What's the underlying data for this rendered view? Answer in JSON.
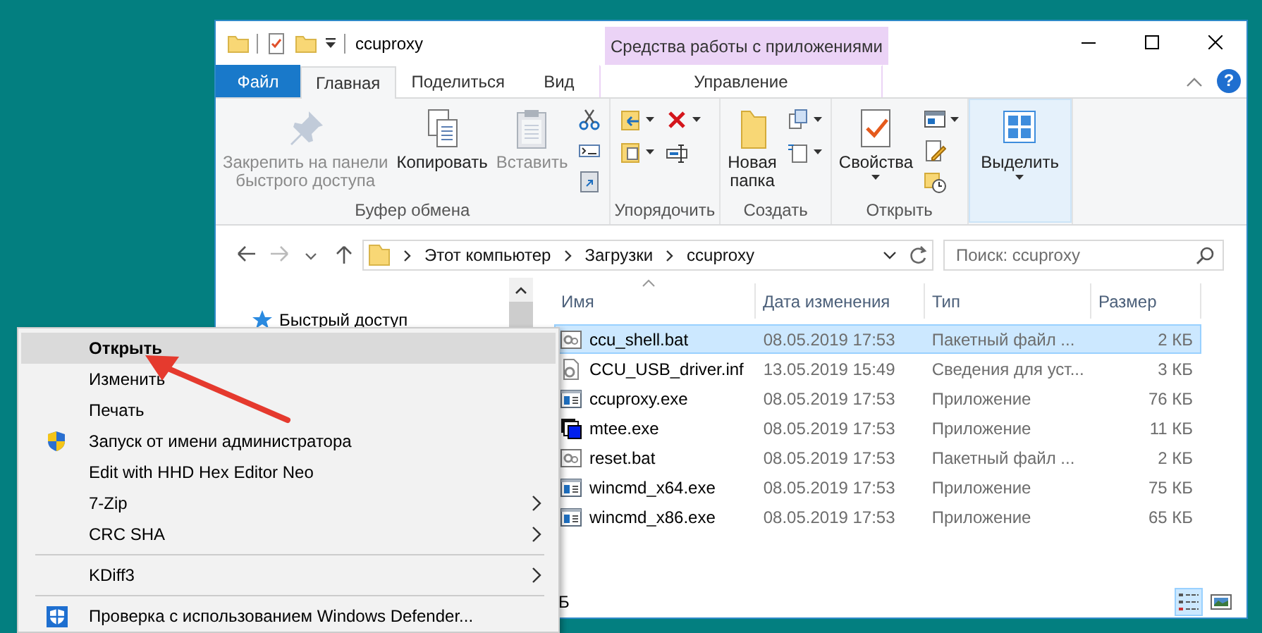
{
  "window": {
    "title": "ccuproxy",
    "contextual_group": "Средства работы с приложениями",
    "help": "?"
  },
  "tabs": [
    {
      "label": "Файл",
      "kind": "file",
      "selected": false
    },
    {
      "label": "Главная",
      "kind": "tab",
      "selected": true
    },
    {
      "label": "Поделиться",
      "kind": "tab",
      "selected": false
    },
    {
      "label": "Вид",
      "kind": "tab",
      "selected": false
    },
    {
      "label": "Управление",
      "kind": "contextual",
      "selected": false
    }
  ],
  "ribbon": [
    {
      "label": "Буфер обмена",
      "commands": [
        {
          "kind": "pin",
          "label": "Закрепить на панели\nбыстрого доступа",
          "disabled": true,
          "highlighted": false
        },
        {
          "kind": "copy",
          "label": "Копировать",
          "disabled": false,
          "highlighted": false
        },
        {
          "kind": "paste",
          "label": "Вставить",
          "disabled": true,
          "highlighted": false
        },
        {
          "kind": "cut",
          "disabled": false,
          "highlighted": false
        },
        {
          "kind": "copy-path",
          "disabled": false,
          "highlighted": false
        },
        {
          "kind": "paste-shortcut",
          "disabled": false,
          "highlighted": false
        }
      ]
    },
    {
      "label": "Упорядочить",
      "commands": [
        {
          "kind": "move-to",
          "disabled": false,
          "highlighted": false
        },
        {
          "kind": "copy-to",
          "disabled": false,
          "highlighted": false
        },
        {
          "kind": "delete",
          "disabled": false,
          "highlighted": false
        },
        {
          "kind": "rename",
          "disabled": false,
          "highlighted": false
        }
      ]
    },
    {
      "label": "Создать",
      "commands": [
        {
          "kind": "new-folder",
          "label": "Новая\nпапка",
          "disabled": false,
          "highlighted": false
        },
        {
          "kind": "new-item",
          "disabled": false,
          "highlighted": false
        },
        {
          "kind": "easy-access",
          "disabled": false,
          "highlighted": false
        }
      ]
    },
    {
      "label": "Открыть",
      "commands": [
        {
          "kind": "properties",
          "label": "Свойства",
          "disabled": false,
          "highlighted": false
        },
        {
          "kind": "open",
          "disabled": false,
          "highlighted": false
        },
        {
          "kind": "edit",
          "disabled": false,
          "highlighted": false
        },
        {
          "kind": "history",
          "disabled": false,
          "highlighted": false
        }
      ]
    },
    {
      "commands": [
        {
          "kind": "select",
          "label": "Выделить",
          "disabled": false,
          "highlighted": true
        }
      ]
    }
  ],
  "address": {
    "crumbs": [
      "Этот компьютер",
      "Загрузки",
      "ccuproxy"
    ]
  },
  "search": {
    "placeholder": "Поиск: ccuproxy"
  },
  "nav_pane": [
    {
      "label": "Быстрый доступ",
      "kind": "quick-access"
    }
  ],
  "file_list": {
    "columns": [
      {
        "label": "Имя",
        "sorted": true
      },
      {
        "label": "Дата изменения",
        "sorted": false
      },
      {
        "label": "Тип",
        "sorted": false
      },
      {
        "label": "Размер",
        "sorted": false
      }
    ],
    "rows": [
      {
        "name": "ccu_shell.bat",
        "date": "08.05.2019 17:53",
        "type": "Пакетный файл ...",
        "size": "2 КБ",
        "kind": "bat",
        "selected": true
      },
      {
        "name": "CCU_USB_driver.inf",
        "date": "13.05.2019 15:49",
        "type": "Сведения для уст...",
        "size": "3 КБ",
        "kind": "inf",
        "selected": false
      },
      {
        "name": "ccuproxy.exe",
        "date": "08.05.2019 17:53",
        "type": "Приложение",
        "size": "76 КБ",
        "kind": "exe",
        "selected": false
      },
      {
        "name": "mtee.exe",
        "date": "08.05.2019 17:53",
        "type": "Приложение",
        "size": "11 КБ",
        "kind": "console",
        "selected": false
      },
      {
        "name": "reset.bat",
        "date": "08.05.2019 17:53",
        "type": "Пакетный файл ...",
        "size": "2 КБ",
        "kind": "bat",
        "selected": false
      },
      {
        "name": "wincmd_x64.exe",
        "date": "08.05.2019 17:53",
        "type": "Приложение",
        "size": "75 КБ",
        "kind": "exe",
        "selected": false
      },
      {
        "name": "wincmd_x86.exe",
        "date": "08.05.2019 17:53",
        "type": "Приложение",
        "size": "65 КБ",
        "kind": "exe",
        "selected": false
      }
    ]
  },
  "status_bar": {
    "text": "Б",
    "view_modes": [
      {
        "kind": "details",
        "selected": true
      },
      {
        "kind": "tiles",
        "selected": false
      }
    ]
  },
  "context_menu": [
    {
      "kind": "item",
      "label": "Открыть",
      "default": true,
      "selected": true,
      "submenu": false
    },
    {
      "kind": "item",
      "label": "Изменить",
      "default": false,
      "selected": false,
      "submenu": false
    },
    {
      "kind": "item",
      "label": "Печать",
      "default": false,
      "selected": false,
      "submenu": false
    },
    {
      "kind": "shield",
      "label": "Запуск от имени администратора",
      "default": false,
      "selected": false,
      "submenu": false
    },
    {
      "kind": "item",
      "label": "Edit with HHD Hex Editor Neo",
      "default": false,
      "selected": false,
      "submenu": false
    },
    {
      "kind": "item",
      "label": "7-Zip",
      "default": false,
      "selected": false,
      "submenu": true
    },
    {
      "kind": "item",
      "label": "CRC SHA",
      "default": false,
      "selected": false,
      "submenu": true
    },
    {
      "kind": "separator"
    },
    {
      "kind": "item",
      "label": "KDiff3",
      "default": false,
      "selected": false,
      "submenu": true
    },
    {
      "kind": "separator"
    },
    {
      "kind": "defender",
      "label": "Проверка с использованием Windows Defender...",
      "default": false,
      "selected": false,
      "submenu": false
    }
  ]
}
